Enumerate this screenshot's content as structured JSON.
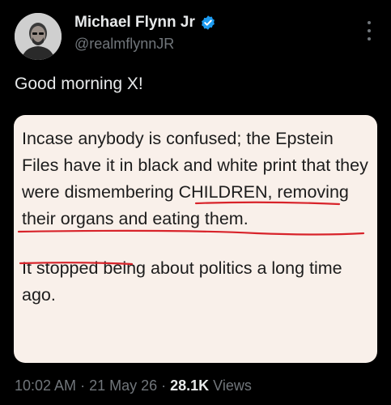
{
  "author": {
    "display_name": "Michael Flynn Jr",
    "handle": "@realmflynnJR",
    "avatar_icon": "person-avatar",
    "verified_icon": "verified-badge-icon",
    "verified_color": "#1d9bf0"
  },
  "tweet": {
    "text": "Good morning X!"
  },
  "quote_card": {
    "paragraph_1": {
      "segment_a": "Incase anybody is confused; the Epstein Files have it in black and white print that they were ",
      "segment_b_underlined": "dismembering CHILDREN, removing their organs and eating them",
      "segment_c": "."
    },
    "paragraph_2": "It stopped being about politics a long time ago.",
    "background_color": "#f9f0ea",
    "underline_color": "#d8232a"
  },
  "meta": {
    "time": "10:02 AM",
    "separator_1": " · ",
    "date": "21 May 26",
    "separator_2": " · ",
    "views_count": "28.1K",
    "views_label": " Views"
  },
  "more_icon": "more-vertical-icon"
}
